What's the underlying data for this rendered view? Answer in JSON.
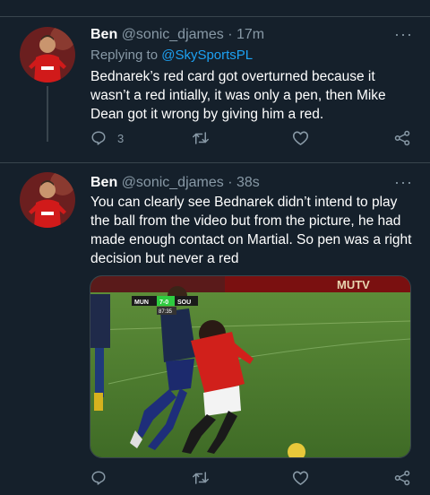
{
  "tweet1": {
    "name": "Ben",
    "handle": "@sonic_djames",
    "separator": "·",
    "time": "17m",
    "replying_prefix": "Replying to",
    "replying_to": "@SkySportsPL",
    "text": "Bednarek’s red card got overturned because it wasn’t a red intially, it was only a pen, then Mike Dean got it wrong by giving him a red.",
    "reply_count": "3",
    "more": "···"
  },
  "tweet2": {
    "name": "Ben",
    "handle": "@sonic_djames",
    "separator": "·",
    "time": "38s",
    "text": "You can clearly see Bednarek didn’t intend to play the ball from the video but from the picture, he had made enough contact on Martial. So pen was a right decision but never a red",
    "more": "···",
    "media": {
      "score_home": "MUN",
      "score": "7-0",
      "score_away": "SOU",
      "clock": "87:35",
      "board_text": "MUTV"
    }
  },
  "colors": {
    "background": "#15202b",
    "border": "#38444d",
    "secondary_text": "#8899a6",
    "accent": "#1da1f2"
  },
  "icons": [
    "reply-icon",
    "retweet-icon",
    "like-icon",
    "share-icon",
    "more-icon"
  ]
}
